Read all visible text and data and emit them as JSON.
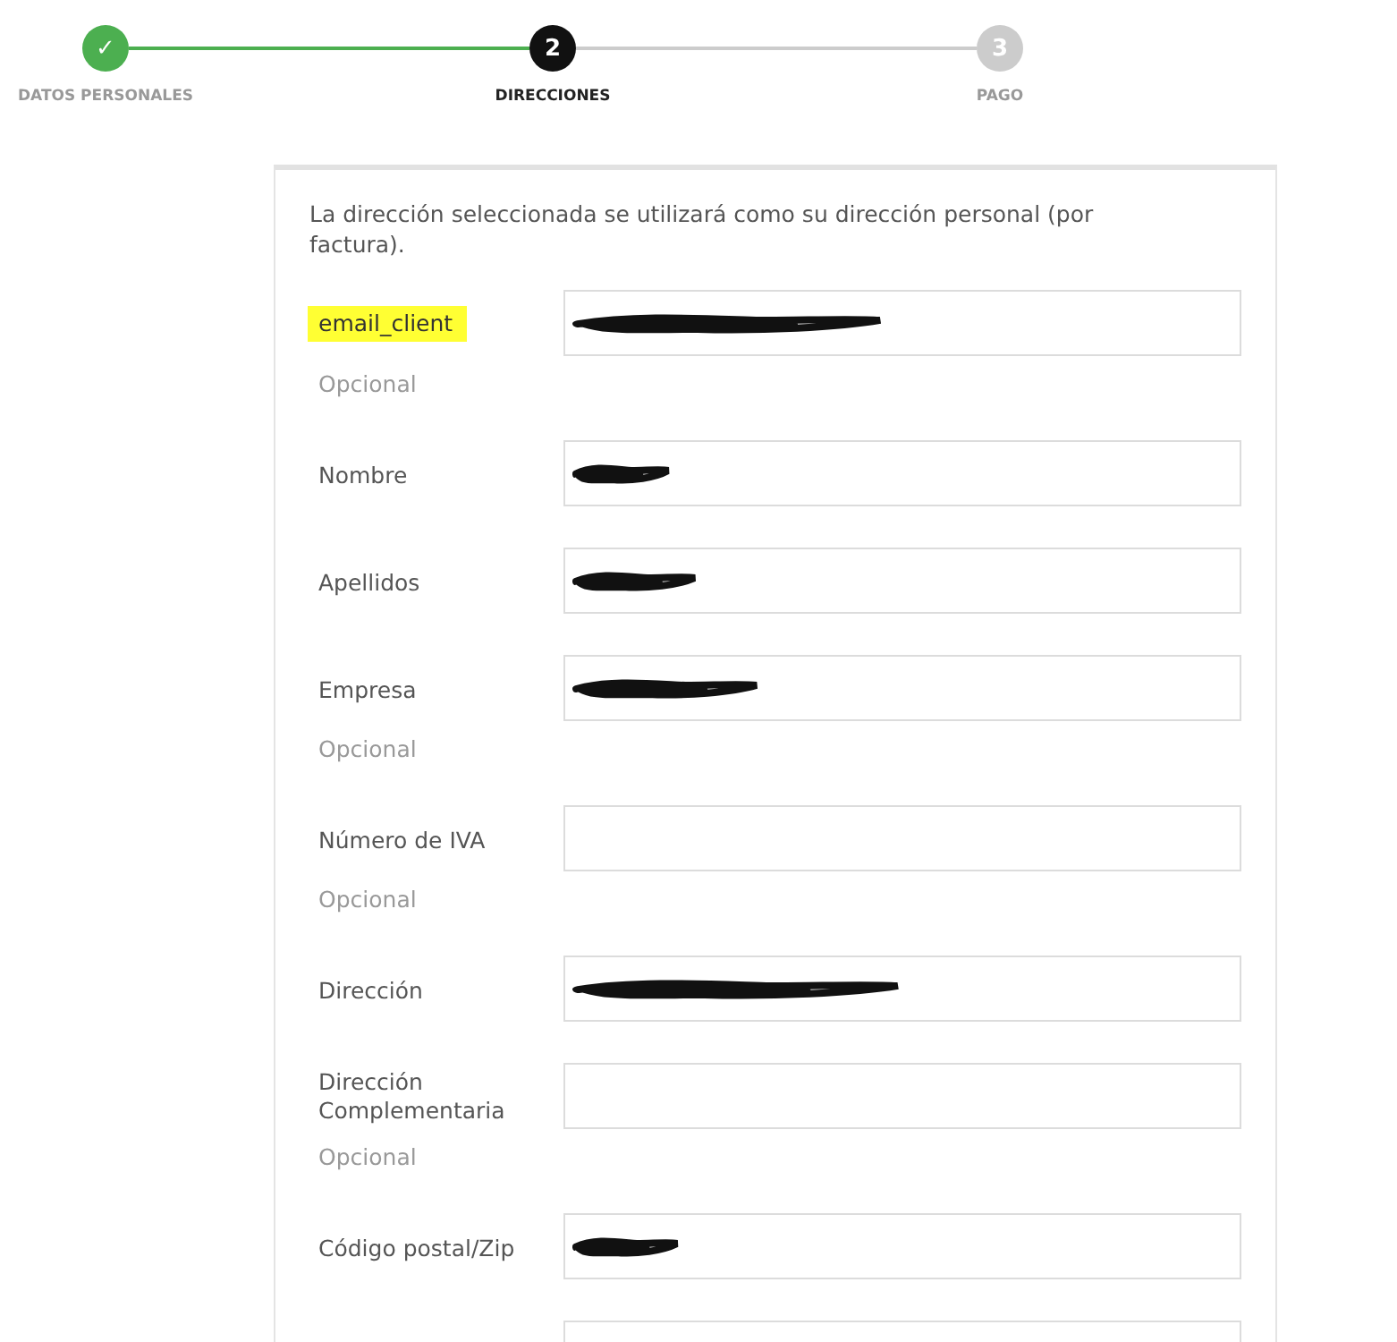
{
  "steps": [
    {
      "number": "✓",
      "label": "DATOS PERSONALES",
      "completed": true,
      "selected": false
    },
    {
      "number": "2",
      "label": "DIRECCIONES",
      "completed": false,
      "selected": true
    },
    {
      "number": "3",
      "label": "PAGO",
      "completed": false,
      "selected": false
    }
  ],
  "form": {
    "intro": "La dirección seleccionada se utilizará como su dirección personal (por factura).",
    "fields": [
      {
        "label": "email_client",
        "highlighted": true,
        "redacted": true,
        "note": "Opcional"
      },
      {
        "label": "Nombre",
        "highlighted": false,
        "redacted": true
      },
      {
        "label": "Apellidos",
        "highlighted": false,
        "redacted": true
      },
      {
        "label": "Empresa",
        "highlighted": false,
        "redacted": true,
        "note": "Opcional"
      },
      {
        "label": "Número de IVA",
        "highlighted": false,
        "redacted": false,
        "note": "Opcional"
      },
      {
        "label": "Dirección",
        "highlighted": false,
        "redacted": true
      },
      {
        "label": "Dirección Complementaria",
        "highlighted": false,
        "redacted": false,
        "note": "Opcional"
      },
      {
        "label": "Código postal/Zip",
        "highlighted": false,
        "redacted": true
      }
    ]
  }
}
